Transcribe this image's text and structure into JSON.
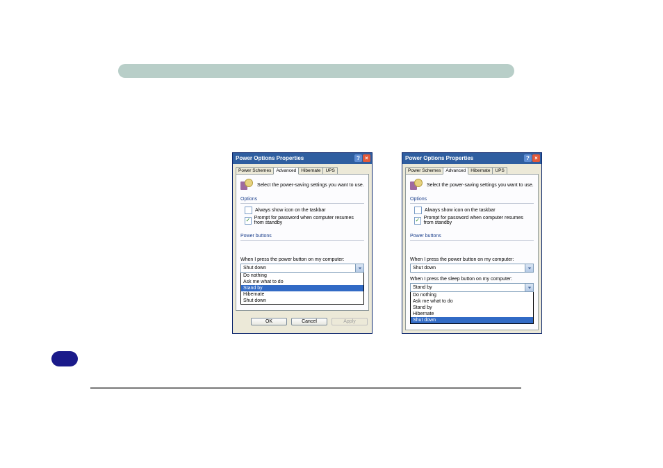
{
  "dialog_title": "Power Options Properties",
  "tabs": [
    "Power Schemes",
    "Advanced",
    "Hibernate",
    "UPS"
  ],
  "active_tab_index": 1,
  "panel_intro": "Select the power-saving settings you want to use.",
  "group_options": "Options",
  "group_power_buttons": "Power buttons",
  "checkbox_show_icon": "Always show icon on the taskbar",
  "checkbox_prompt_password": "Prompt for password when computer resumes from standby",
  "checkbox_show_icon_checked": false,
  "checkbox_prompt_password_checked": true,
  "label_power_button": "When I press the power button on my computer:",
  "label_sleep_button": "When I press the sleep button on my computer:",
  "combo_value_shutdown": "Shut down",
  "combo_value_standby": "Stand by",
  "dropdown_options": [
    "Do nothing",
    "Ask me what to do",
    "Stand by",
    "Hibernate",
    "Shut down"
  ],
  "left_dropdown_selected": "Stand by",
  "right_dropdown_selected": "Shut down",
  "buttons": {
    "ok": "OK",
    "cancel": "Cancel",
    "apply": "Apply"
  }
}
